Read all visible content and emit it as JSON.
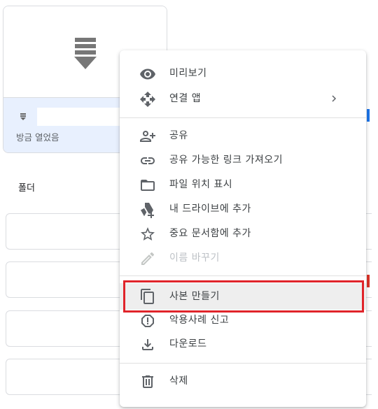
{
  "file_card": {
    "subtitle": "방금 열었음"
  },
  "sections": {
    "folders_label": "폴더"
  },
  "context_menu": {
    "items": [
      {
        "label": "미리보기",
        "icon": "eye-icon"
      },
      {
        "label": "연결 앱",
        "icon": "move-arrows-icon",
        "has_submenu": true
      },
      {
        "label": "공유",
        "icon": "person-add-icon"
      },
      {
        "label": "공유 가능한 링크 가져오기",
        "icon": "link-icon"
      },
      {
        "label": "파일 위치 표시",
        "icon": "folder-icon"
      },
      {
        "label": "내 드라이브에 추가",
        "icon": "drive-add-icon"
      },
      {
        "label": "중요 문서함에 추가",
        "icon": "star-icon"
      },
      {
        "label": "이름 바꾸기",
        "icon": "pencil-icon",
        "disabled": true
      },
      {
        "label": "사본 만들기",
        "icon": "copy-icon",
        "highlighted": true
      },
      {
        "label": "악용사례 신고",
        "icon": "report-icon"
      },
      {
        "label": "다운로드",
        "icon": "download-icon"
      },
      {
        "label": "삭제",
        "icon": "trash-icon"
      }
    ]
  },
  "colors": {
    "accent": "#1a73e8",
    "selection_bg": "#e8f0fe",
    "highlight_border": "#e0242a",
    "icon": "#5f6368"
  }
}
